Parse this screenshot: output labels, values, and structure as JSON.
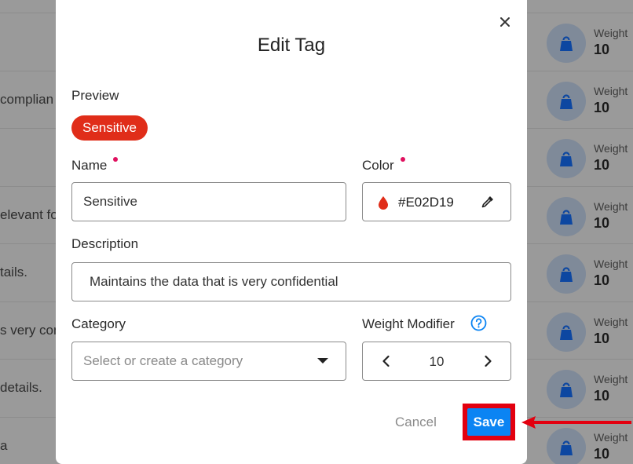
{
  "background": {
    "rows": [
      {
        "desc": "",
        "weight_label": "Weight",
        "weight_value": "10"
      },
      {
        "desc": "complian",
        "weight_label": "Weight",
        "weight_value": "10"
      },
      {
        "desc": "",
        "weight_label": "Weight",
        "weight_value": "10"
      },
      {
        "desc": "elevant fo",
        "weight_label": "Weight",
        "weight_value": "10"
      },
      {
        "desc": "tails.",
        "weight_label": "Weight",
        "weight_value": "10"
      },
      {
        "desc": "s very con",
        "weight_label": "Weight",
        "weight_value": "10"
      },
      {
        "desc": "details.",
        "weight_label": "Weight",
        "weight_value": "10"
      },
      {
        "desc": "a",
        "weight_label": "Weight",
        "weight_value": "10"
      }
    ],
    "weight_icon": "weight-icon"
  },
  "modal": {
    "title": "Edit Tag",
    "close_icon": "close-icon",
    "preview_label": "Preview",
    "preview_tag": "Sensitive",
    "name_label": "Name",
    "name_value": "Sensitive",
    "color_label": "Color",
    "color_value": "#E02D19",
    "description_label": "Description",
    "description_value": "Maintains the data that is very confidential",
    "category_label": "Category",
    "category_placeholder": "Select or create a category",
    "weight_label": "Weight Modifier",
    "weight_value": "10",
    "cancel_label": "Cancel",
    "save_label": "Save"
  },
  "colors": {
    "tag": "#E02D19",
    "primary": "#0b84f3",
    "highlight": "#e3000f"
  }
}
